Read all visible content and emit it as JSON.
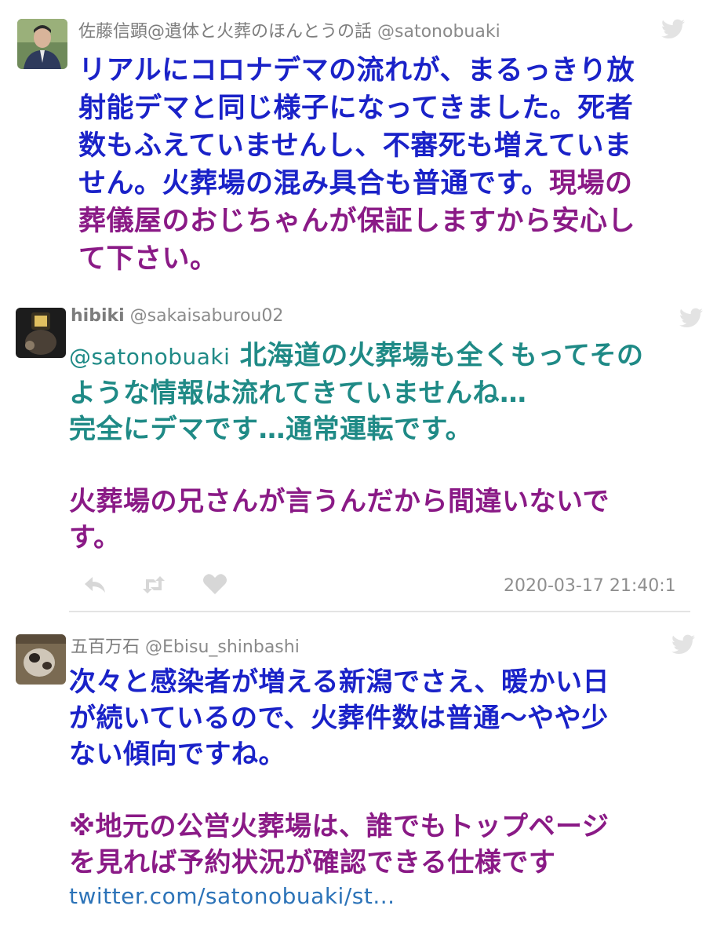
{
  "tweets": [
    {
      "display_name": "佐藤信顕@遺体と火葬のほんとうの話",
      "handle": "@satonobuaki",
      "lines": [
        [
          {
            "text": "リアルにコロナデマの流れが、まるっきり放",
            "color": "blue"
          }
        ],
        [
          {
            "text": "射能デマと同じ様子になってきました。死者",
            "color": "blue"
          }
        ],
        [
          {
            "text": "数もふえていませんし、不審死も増えていま",
            "color": "blue"
          }
        ],
        [
          {
            "text": "せん。火葬場の混み具合も普通です。",
            "color": "blue"
          },
          {
            "text": "現場の",
            "color": "purple"
          }
        ],
        [
          {
            "text": "葬儀屋のおじちゃんが保証しますから安心し",
            "color": "purple"
          }
        ],
        [
          {
            "text": "て下さい。",
            "color": "purple"
          }
        ]
      ]
    },
    {
      "display_name": "hibiki",
      "handle": "@sakaisaburou02",
      "mention": "@satonobuaki",
      "lines": [
        [
          {
            "text": "北海道の火葬場も全くもってその",
            "color": "teal"
          }
        ],
        [
          {
            "text": "ような情報は流れてきていませんね…",
            "color": "teal"
          }
        ],
        [
          {
            "text": "完全にデマです…通常運転です。",
            "color": "teal"
          }
        ],
        [
          {
            "text": "",
            "color": "teal"
          }
        ],
        [
          {
            "text": "火葬場の兄さんが言うんだから間違いないで",
            "color": "purple"
          }
        ],
        [
          {
            "text": "す。",
            "color": "purple"
          }
        ]
      ],
      "timestamp": "2020-03-17 21:40:1"
    },
    {
      "display_name": "五百万石",
      "handle": "@Ebisu_shinbashi",
      "lines": [
        [
          {
            "text": "次々と感染者が増える新潟でさえ、暖かい日",
            "color": "blue"
          }
        ],
        [
          {
            "text": "が続いているので、火葬件数は普通〜やや少",
            "color": "blue"
          }
        ],
        [
          {
            "text": "ない傾向ですね。",
            "color": "blue"
          }
        ],
        [
          {
            "text": "",
            "color": "blue"
          }
        ],
        [
          {
            "text": "※地元の公営火葬場は、誰でもトップページ",
            "color": "purple"
          }
        ],
        [
          {
            "text": "を見れば予約状況が確認できる仕様です",
            "color": "purple"
          }
        ]
      ],
      "link": "twitter.com/satonobuaki/st..."
    }
  ],
  "icons": [
    "twitter-bird-icon",
    "reply-icon",
    "retweet-icon",
    "like-icon"
  ],
  "colors": {
    "blue": "#1a22c8",
    "purple": "#8a1a86",
    "teal": "#1f8a86",
    "link": "#2c73b8",
    "meta": "#8a8a8a"
  }
}
